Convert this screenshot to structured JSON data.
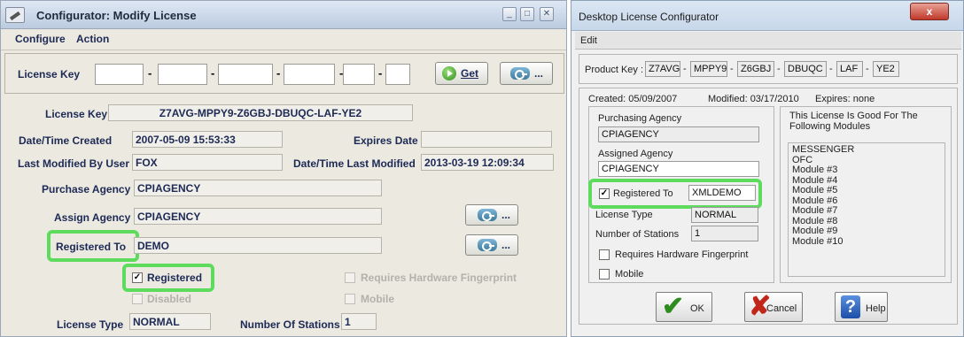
{
  "left": {
    "title": "Configurator: Modify License",
    "menu": [
      "Configure",
      "Action"
    ],
    "key_row": {
      "label": "License Key",
      "dash": "-",
      "get_label": "Get",
      "lookup_label": "..."
    },
    "fields": {
      "license_key_label": "License Key",
      "license_key_value": "Z7AVG-MPPY9-Z6GBJ-DBUQC-LAF-YE2",
      "created_label": "Date/Time Created",
      "created_value": "2007-05-09 15:53:33",
      "expires_label": "Expires Date",
      "expires_value": "",
      "modified_by_label": "Last Modified By User",
      "modified_by_value": "FOX",
      "modified_label": "Date/Time Last Modified",
      "modified_value": "2013-03-19 12:09:34",
      "purchase_label": "Purchase Agency",
      "purchase_value": "CPIAGENCY",
      "assign_label": "Assign Agency",
      "assign_value": "CPIAGENCY",
      "registered_to_label": "Registered To",
      "registered_to_value": "DEMO",
      "license_type_label": "License Type",
      "license_type_value": "NORMAL",
      "stations_label": "Number Of Stations",
      "stations_value": "1"
    },
    "lookup_label": "...",
    "checkboxes": {
      "registered": {
        "label": "Registered",
        "mark": "✓"
      },
      "disabled": {
        "label": "Disabled"
      },
      "fingerprint": {
        "label": "Requires Hardware Fingerprint"
      },
      "mobile": {
        "label": "Mobile"
      }
    }
  },
  "right": {
    "title": "Desktop License Configurator",
    "close_label": "x",
    "menu": [
      "Edit"
    ],
    "product_key_label": "Product Key :",
    "product_key_parts": [
      "Z7AVG",
      "MPPY9",
      "Z6GBJ",
      "DBUQC",
      "LAF",
      "YE2"
    ],
    "key_dash": "-",
    "created": "Created: 05/09/2007",
    "modified": "Modified: 03/17/2010",
    "expires": "Expires: none",
    "purchasing_label": "Purchasing Agency",
    "purchasing_value": "CPIAGENCY",
    "assigned_label": "Assigned Agency",
    "assigned_value": "CPIAGENCY",
    "registered_to_label": "Registered To",
    "registered_to_value": "XMLDEMO",
    "registered_mark": "✓",
    "license_type_label": "License Type",
    "license_type_value": "NORMAL",
    "stations_label": "Number of Stations",
    "stations_value": "1",
    "fingerprint_label": "Requires Hardware Fingerprint",
    "mobile_label": "Mobile",
    "modules_title": "This License Is Good For The Following Modules",
    "modules": [
      "MESSENGER",
      "OFC",
      "Module #3",
      "Module #4",
      "Module #5",
      "Module #6",
      "Module #7",
      "Module #8",
      "Module #9",
      "Module #10"
    ],
    "ok_label": "OK",
    "cancel_label": "Cancel",
    "help_label": "Help"
  },
  "colors": {
    "highlight": "#5ddb5d",
    "label_blue": "#1d2a55"
  }
}
